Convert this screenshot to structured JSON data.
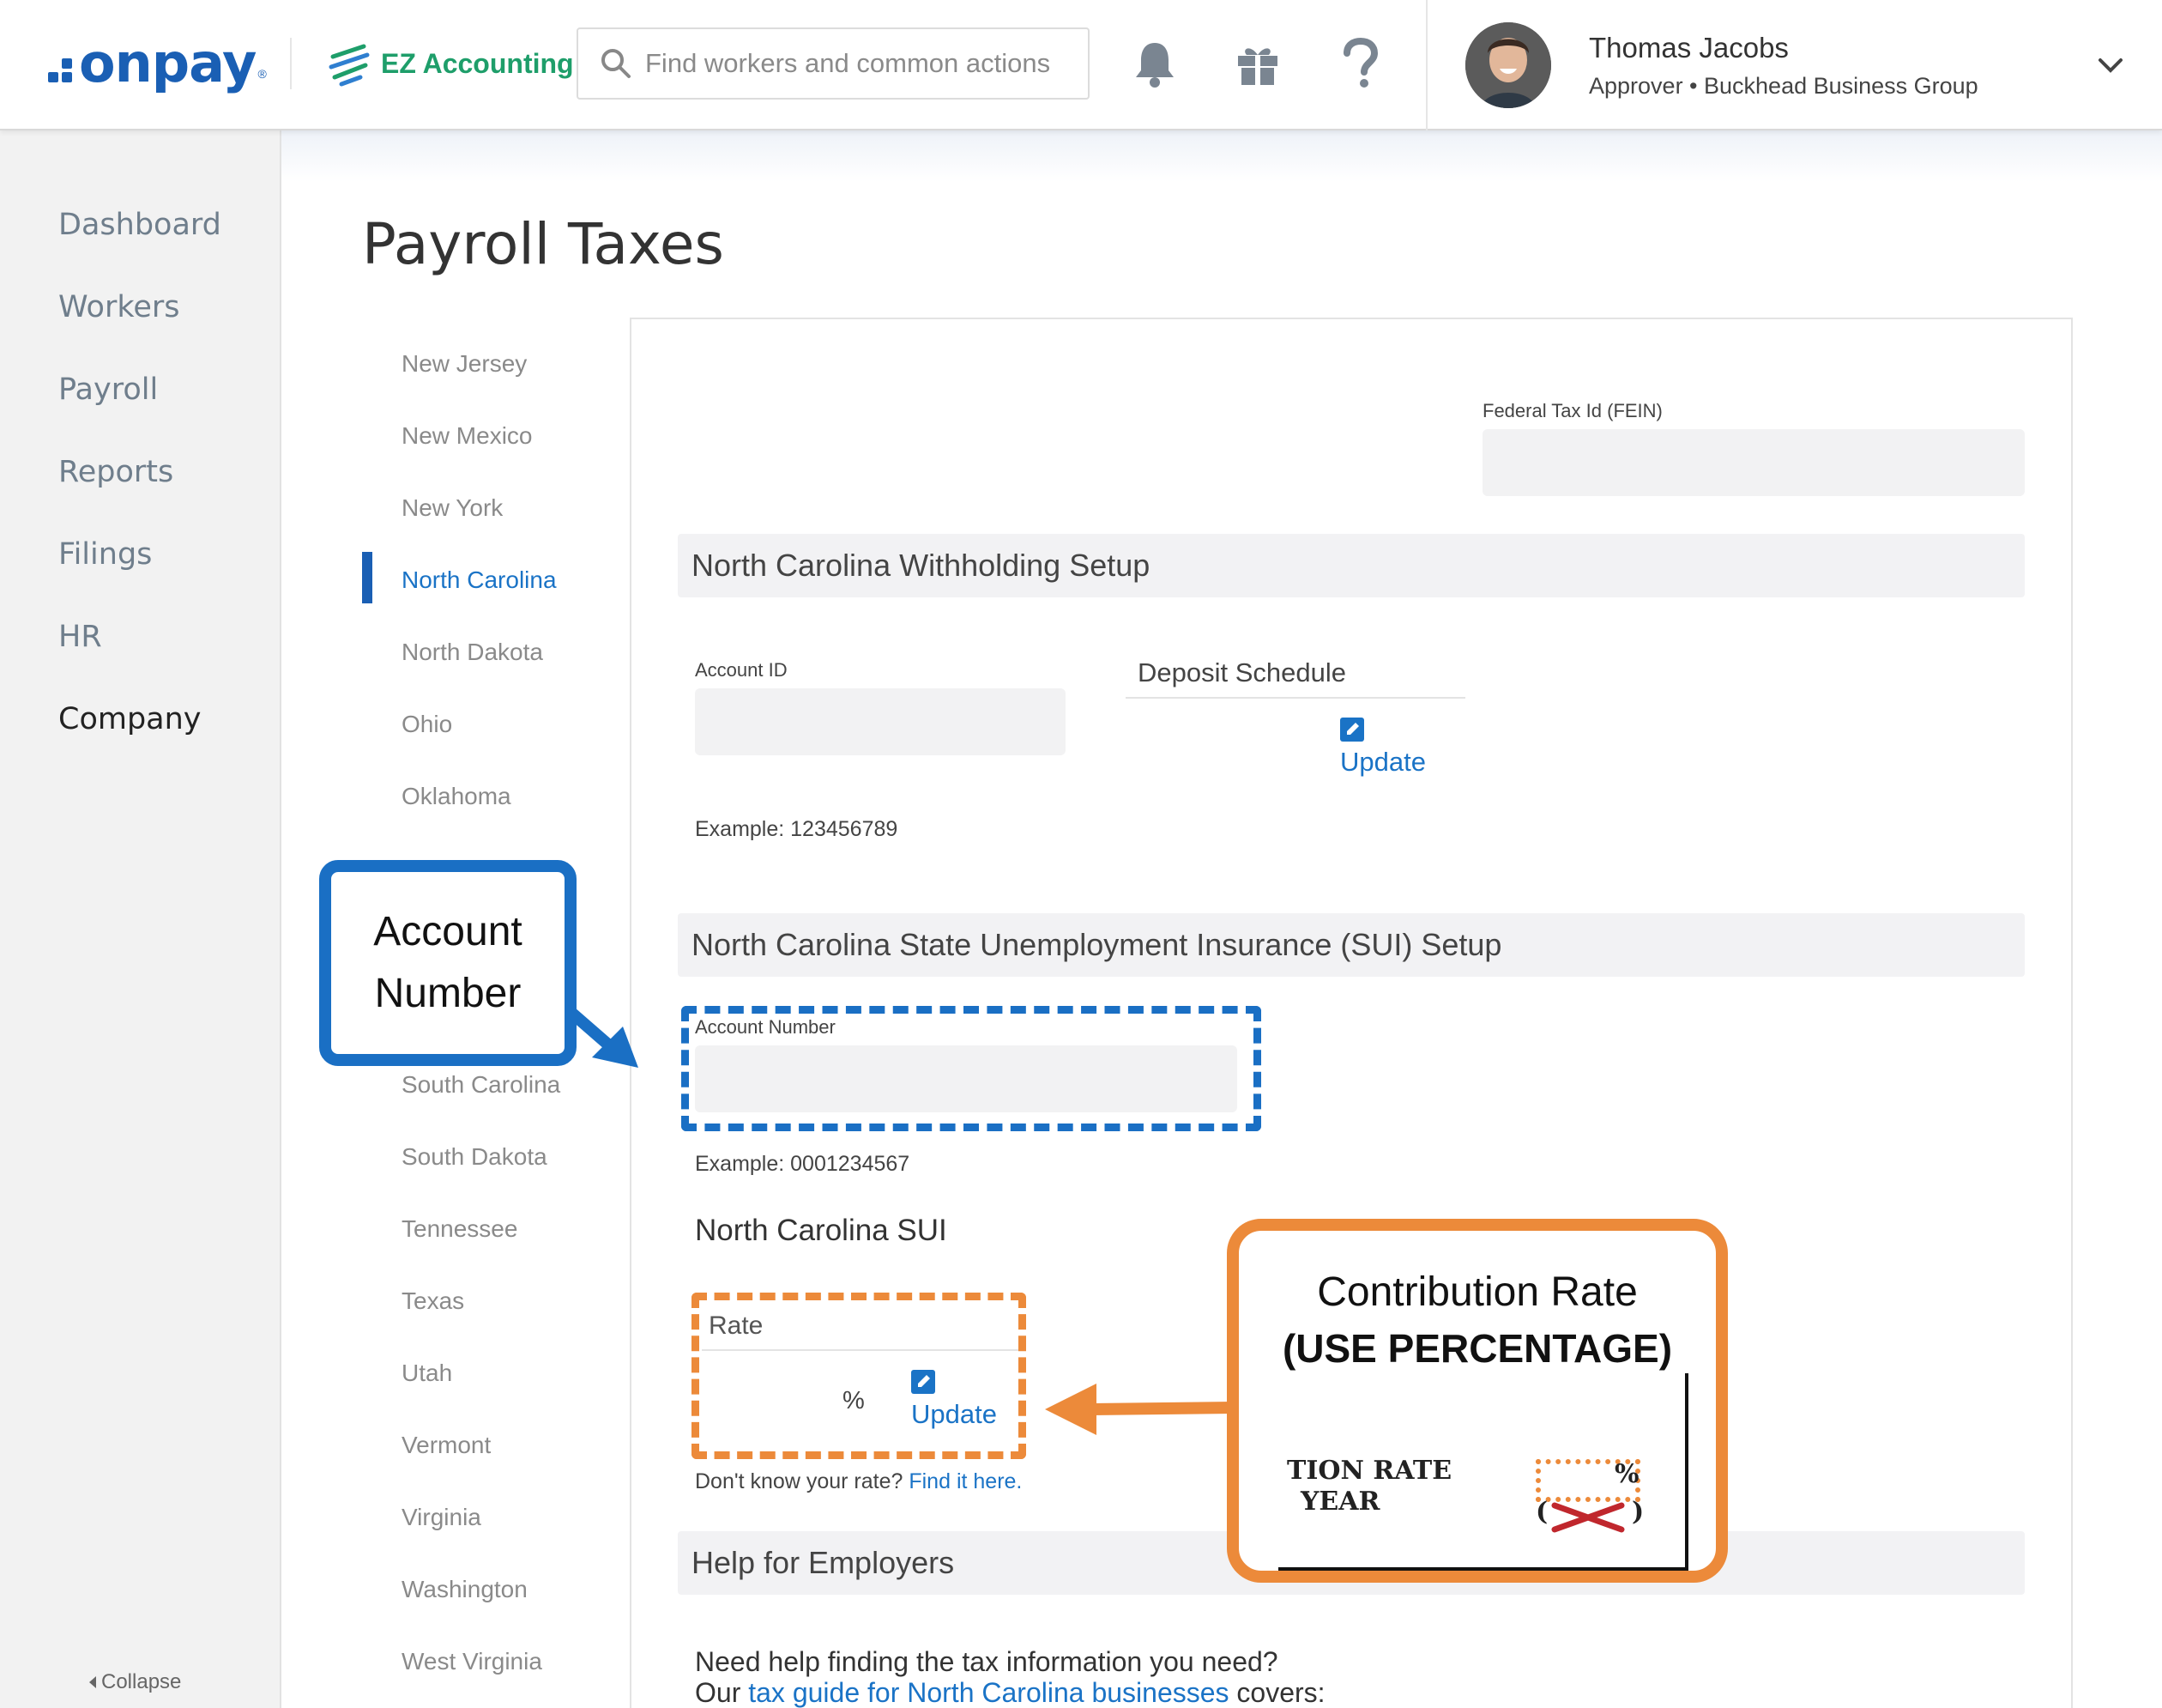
{
  "header": {
    "logo_text": "onpay",
    "logo_reg": "®",
    "partner_name": "EZ Accounting",
    "search_placeholder": "Find workers and common actions",
    "user_name": "Thomas Jacobs",
    "user_role": "Approver • Buckhead Business Group"
  },
  "sidebar": {
    "items": [
      "Dashboard",
      "Workers",
      "Payroll",
      "Reports",
      "Filings",
      "HR",
      "Company"
    ],
    "active": "Company",
    "collapse_label": "Collapse"
  },
  "page_title": "Payroll Taxes",
  "states": {
    "top": [
      "New Jersey",
      "New Mexico",
      "New York",
      "North Carolina",
      "North Dakota",
      "Ohio",
      "Oklahoma"
    ],
    "active": "North Carolina",
    "bottom": [
      "South Carolina",
      "South Dakota",
      "Tennessee",
      "Texas",
      "Utah",
      "Vermont",
      "Virginia",
      "Washington",
      "West Virginia"
    ]
  },
  "form": {
    "fein_label": "Federal Tax Id (FEIN)",
    "withholding_title": "North Carolina Withholding Setup",
    "account_id_label": "Account ID",
    "account_id_example": "Example: 123456789",
    "deposit_schedule_label": "Deposit Schedule",
    "update_label": "Update",
    "sui_setup_title": "North Carolina State Unemployment Insurance (SUI) Setup",
    "account_number_label": "Account Number",
    "account_number_example": "Example: 0001234567",
    "sui_title": "North Carolina SUI",
    "rate_label": "Rate",
    "percent_sign": "%",
    "rate_update_label": "Update",
    "dont_know_text": "Don't know your rate?",
    "find_it_link": "Find it here.",
    "help_title": "Help for Employers",
    "help_line1": "Need help finding the tax information you need?",
    "help_line2_prefix": "Our",
    "help_line2_link": "tax guide for North Carolina businesses",
    "help_line2_suffix": "covers:"
  },
  "annotations": {
    "account_number_callout_line1": "Account",
    "account_number_callout_line2": "Number",
    "contribution_callout_line1": "Contribution Rate",
    "contribution_callout_line2": "(USE PERCENTAGE)",
    "form_crop_line1": "TION RATE",
    "form_crop_line2": "YEAR",
    "form_crop_pct": "%",
    "colors": {
      "blue": "#1a6fc4",
      "orange": "#ec8a3a"
    }
  }
}
